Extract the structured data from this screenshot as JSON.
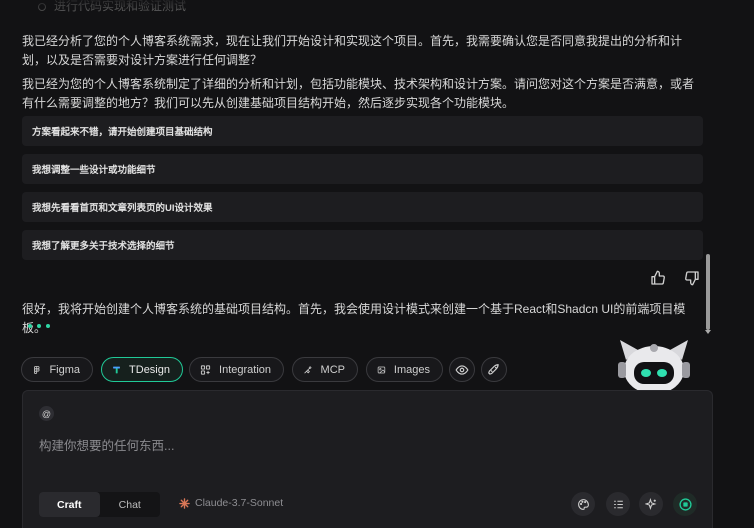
{
  "messages": {
    "prev_cut": "进行代码实现和验证测试",
    "para1": "我已经分析了您的个人博客系统需求，现在让我们开始设计和实现这个项目。首先，我需要确认您是否同意我提出的分析和计划，以及是否需要对设计方案进行任何调整？",
    "para2": "我已经为您的个人博客系统制定了详细的分析和计划，包括功能模块、技术架构和设计方案。请问您对这个方案是否满意，或者有什么需要调整的地方？我们可以先从创建基础项目结构开始，然后逐步实现各个功能模块。",
    "reply": "很好，我将开始创建个人博客系统的基础项目结构。首先，我会使用设计模式来创建一个基于React和Shadcn UI的前端项目模板。"
  },
  "options": [
    "方案看起来不错，请开始创建项目基础结构",
    "我想调整一些设计或功能细节",
    "我想先看看首页和文章列表页的UI设计效果",
    "我想了解更多关于技术选择的细节"
  ],
  "toolbar": {
    "figma": "Figma",
    "tdesign": "TDesign",
    "integration": "Integration",
    "mcp": "MCP",
    "images": "Images"
  },
  "composer": {
    "at": "@",
    "placeholder": "构建你想要的任何东西...",
    "mode_craft": "Craft",
    "mode_chat": "Chat",
    "model": "Claude-3.7-Sonnet"
  },
  "colors": {
    "accent": "#20c997",
    "background": "#121214",
    "panel": "#1d1d20"
  },
  "icons": [
    "thumbs-up-icon",
    "thumbs-down-icon",
    "figma-icon",
    "tdesign-icon",
    "integration-icon",
    "mcp-icon",
    "images-icon",
    "eye-icon",
    "rocket-icon",
    "palette-icon",
    "list-icon",
    "sparkle-icon",
    "stop-icon",
    "robot-mascot-icon"
  ]
}
